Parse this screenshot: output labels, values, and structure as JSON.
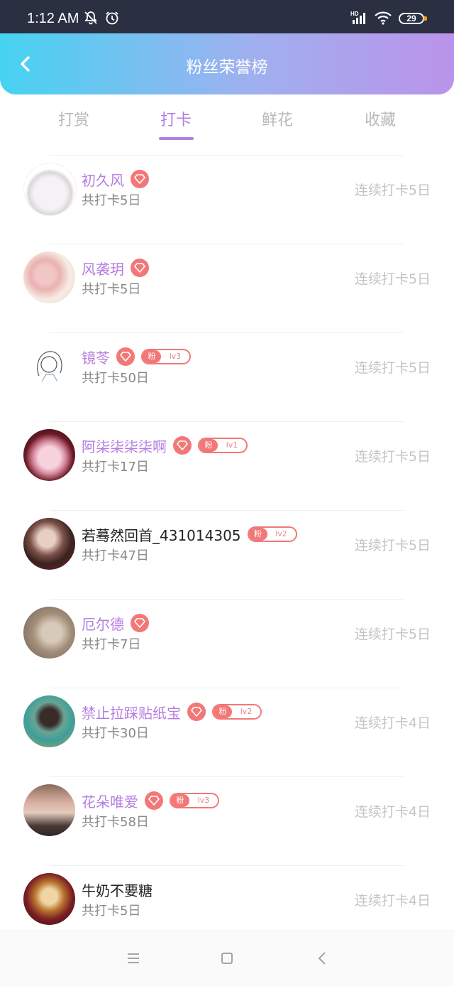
{
  "status_bar": {
    "time": "1:12 AM",
    "battery": "29",
    "icons": [
      "mute-notification-icon",
      "alarm-icon",
      "hd-signal-icon",
      "wifi-icon",
      "battery-icon"
    ]
  },
  "header": {
    "title": "粉丝荣誉榜",
    "back_icon": "chevron-left-icon",
    "gradient": [
      "#46d3f2",
      "#bb93ea"
    ]
  },
  "tabs": [
    {
      "label": "打赏",
      "active": false
    },
    {
      "label": "打卡",
      "active": true
    },
    {
      "label": "鲜花",
      "active": false
    },
    {
      "label": "收藏",
      "active": false
    }
  ],
  "colors": {
    "accent": "#b47ee0",
    "gem": "#f27878",
    "muted": "#c4c4c4"
  },
  "fans": [
    {
      "name": "初久风",
      "name_colored": true,
      "badge": null,
      "total": "共打卡5日",
      "streak": "连续打卡5日"
    },
    {
      "name": "风袭玥",
      "name_colored": true,
      "badge": null,
      "total": "共打卡5日",
      "streak": "连续打卡5日"
    },
    {
      "name": "镜苓",
      "name_colored": true,
      "badge": {
        "fan": "粉",
        "level": "lv3"
      },
      "total": "共打卡50日",
      "streak": "连续打卡5日"
    },
    {
      "name": "阿柒柒柒柒啊",
      "name_colored": true,
      "badge": {
        "fan": "粉",
        "level": "lv1"
      },
      "total": "共打卡17日",
      "streak": "连续打卡5日"
    },
    {
      "name": "若蓦然回首_431014305",
      "name_colored": false,
      "badge": {
        "fan": "粉",
        "level": "lv2"
      },
      "total": "共打卡47日",
      "streak": "连续打卡5日"
    },
    {
      "name": "厄尔德",
      "name_colored": true,
      "badge": null,
      "total": "共打卡7日",
      "streak": "连续打卡5日"
    },
    {
      "name": "禁止拉踩贴纸宝",
      "name_colored": true,
      "badge": {
        "fan": "粉",
        "level": "lv2"
      },
      "total": "共打卡30日",
      "streak": "连续打卡4日"
    },
    {
      "name": "花朵唯爱",
      "name_colored": true,
      "badge": {
        "fan": "粉",
        "level": "lv3"
      },
      "total": "共打卡58日",
      "streak": "连续打卡4日"
    },
    {
      "name": "牛奶不要糖",
      "name_colored": false,
      "badge": null,
      "total": "共打卡5日",
      "streak": "连续打卡4日"
    }
  ],
  "nav_bar": {
    "icons": [
      "menu-icon",
      "home-square-icon",
      "back-triangle-icon"
    ]
  }
}
